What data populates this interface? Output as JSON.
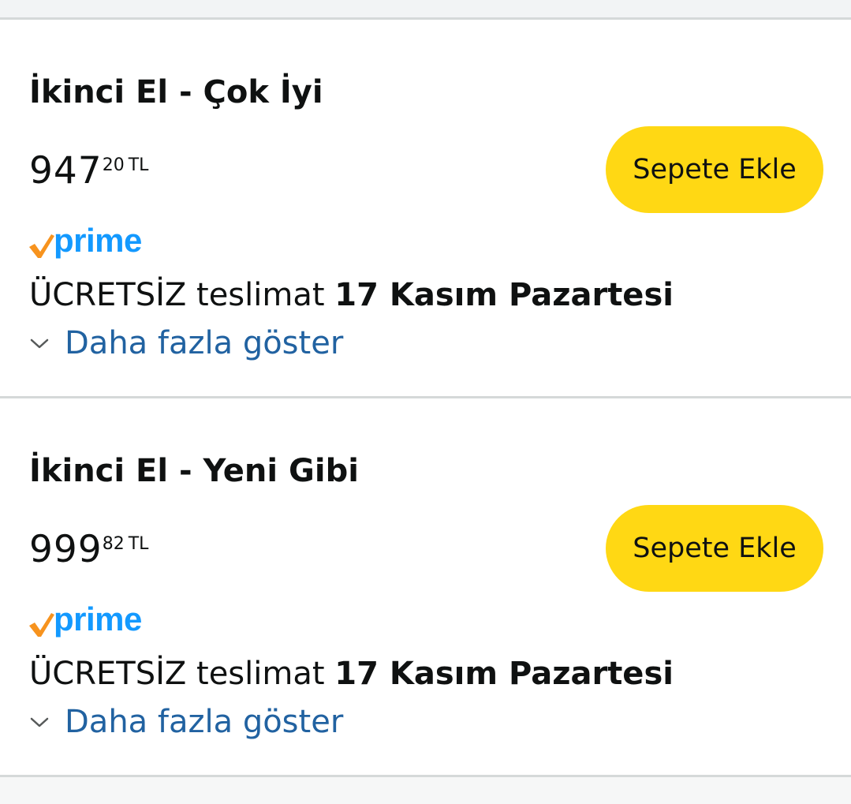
{
  "offers": [
    {
      "condition": "İkinci El - Çok İyi",
      "price_whole": "947",
      "price_fraction": "20",
      "currency": "TL",
      "add_to_cart_label": "Sepete Ekle",
      "prime_label": "prime",
      "delivery_prefix": "ÜCRETSİZ teslimat ",
      "delivery_date": "17 Kasım Pazartesi",
      "show_more_label": "Daha fazla göster"
    },
    {
      "condition": "İkinci El - Yeni Gibi",
      "price_whole": "999",
      "price_fraction": "82",
      "currency": "TL",
      "add_to_cart_label": "Sepete Ekle",
      "prime_label": "prime",
      "delivery_prefix": "ÜCRETSİZ teslimat ",
      "delivery_date": "17 Kasım Pazartesi",
      "show_more_label": "Daha fazla göster"
    }
  ],
  "colors": {
    "button_yellow": "#ffd814",
    "link_blue": "#2162a1",
    "prime_blue": "#1399ff",
    "prime_check_orange": "#f7931e",
    "divider": "#d5d9d9"
  },
  "icons": {
    "prime_check": "prime-check-icon",
    "expand": "chevron-down-icon"
  }
}
